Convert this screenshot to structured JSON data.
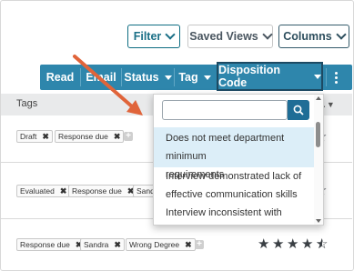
{
  "toolbar": {
    "filter_label": "Filter",
    "saved_views_label": "Saved Views",
    "columns_label": "Columns"
  },
  "actions": {
    "read": "Read",
    "email": "Email",
    "status": "Status",
    "tag": "Tag",
    "disposition_code": "Disposition Code"
  },
  "table": {
    "tags_header": "Tags"
  },
  "rows": [
    {
      "tags": [
        "Draft",
        "Response due"
      ],
      "rating": ""
    },
    {
      "tags": [
        "Evaluated",
        "Response due",
        "Sandra"
      ],
      "rating": ""
    },
    {
      "tags": [
        "Response due",
        "Sandra",
        "Wrong Degree"
      ],
      "rating": 4.5
    }
  ],
  "dropdown": {
    "search_placeholder": "",
    "options": [
      {
        "line1": "Does not meet department minimum",
        "line2": "requirements"
      },
      {
        "line1": "Interview demonstrated lack of",
        "line2": "effective communication skills"
      },
      {
        "line1": "Interview inconsistent with",
        "line2": ""
      }
    ]
  },
  "icons": {
    "remove_tag": "x-icon",
    "add_tag": "plus-icon",
    "search": "search-icon",
    "star": "star-icon",
    "pointer": "arrow-annotation-icon"
  },
  "colors": {
    "primary": "#2e86ac",
    "accent_border": "#0e6d82",
    "selected_option": "#dceef8",
    "annotation_arrow": "#e0643a"
  }
}
